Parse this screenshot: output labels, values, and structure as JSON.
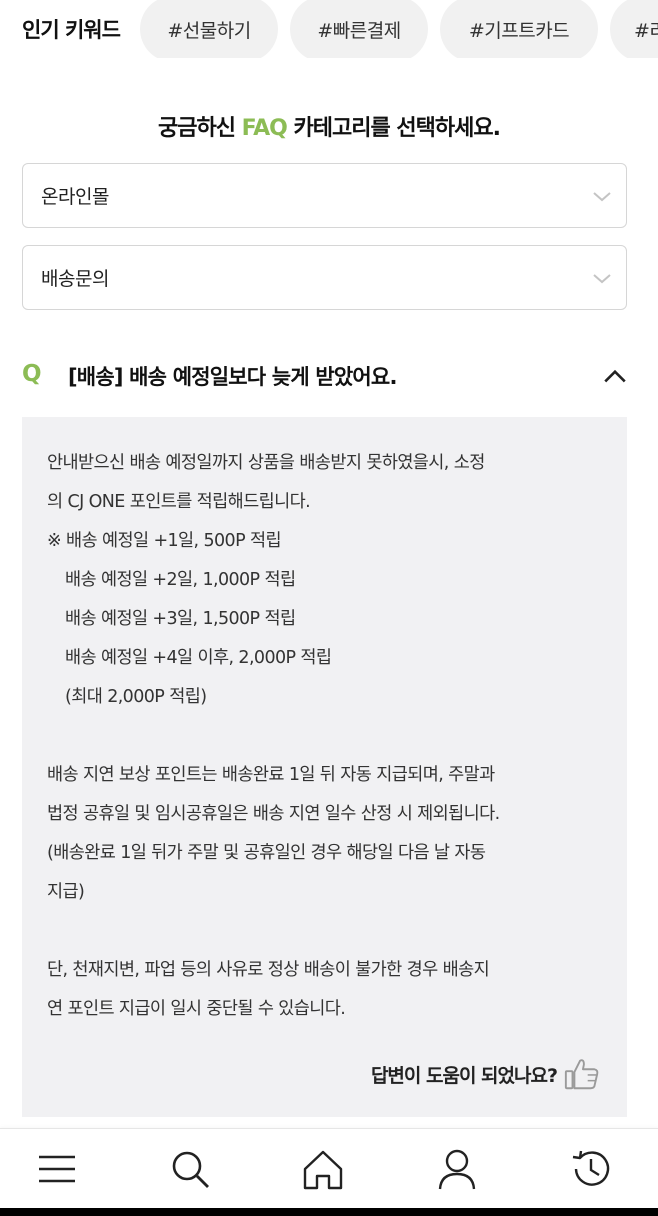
{
  "keywords": {
    "title": "인기 키워드",
    "chips": [
      "#선물하기",
      "#빠른결제",
      "#기프트카드",
      "#리"
    ]
  },
  "faq": {
    "heading_prefix": "궁금하신 ",
    "heading_accent": "FAQ",
    "heading_suffix": " 카테고리를 선택하세요.",
    "accent_color": "#8cbc55",
    "select_category": "온라인몰",
    "select_subcategory": "배송문의"
  },
  "question": {
    "mark": "Q",
    "text": "[배송] 배송 예정일보다 늦게 받았어요.",
    "expanded": true
  },
  "answer": {
    "lines": [
      "안내받으신 배송 예정일까지 상품을 배송받지 못하였을시, 소정",
      "의 CJ ONE 포인트를 적립해드립니다.",
      "※  배송 예정일 +1일, 500P 적립",
      "   배송 예정일 +2일, 1,000P 적립",
      "   배송 예정일 +3일, 1,500P 적립",
      "   배송 예정일 +4일 이후, 2,000P 적립",
      "   (최대 2,000P 적립)",
      "",
      "배송 지연 보상 포인트는 배송완료 1일 뒤 자동 지급되며, 주말과",
      "법정 공휴일 및 임시공휴일은 배송 지연 일수 산정 시 제외됩니다.",
      "(배송완료 1일 뒤가 주말 및 공휴일인 경우 해당일 다음 날 자동",
      "지급)",
      "",
      "단, 천재지변, 파업 등의 사유로 정상 배송이 불가한 경우 배송지",
      "연 포인트 지급이 일시 중단될 수 있습니다."
    ],
    "helpful_text": "답변이 도움이 되었나요?"
  },
  "bottom_nav": {
    "icons": [
      "menu-icon",
      "search-icon",
      "home-icon",
      "user-icon",
      "history-icon"
    ]
  }
}
